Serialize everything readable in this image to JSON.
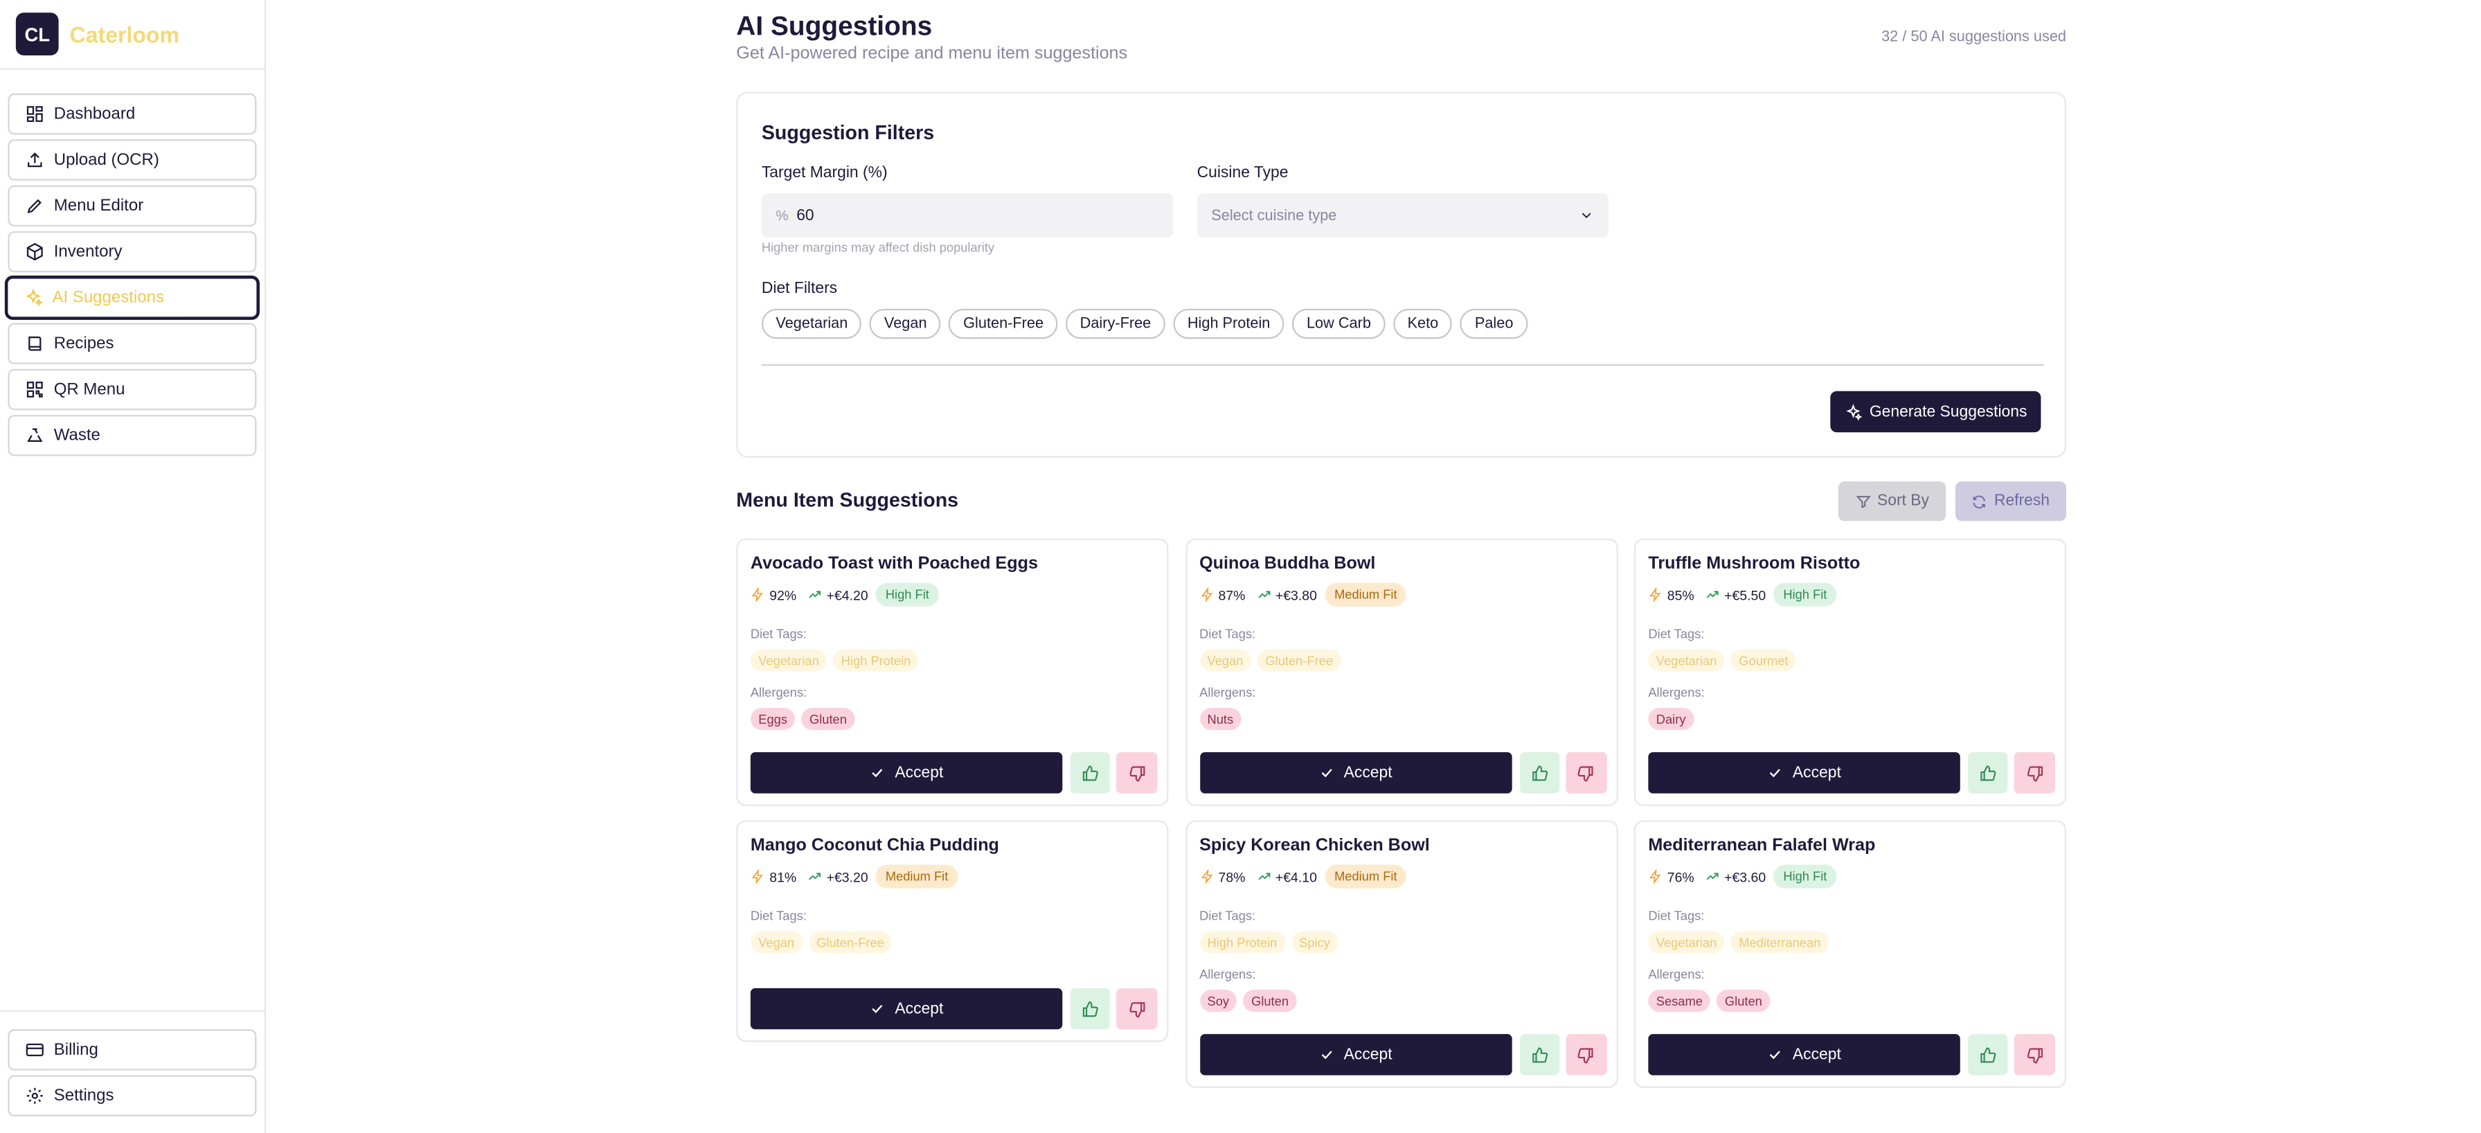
{
  "brand": {
    "logo": "CL",
    "name": "Caterloom"
  },
  "sidebar": {
    "items": [
      {
        "label": "Dashboard",
        "icon": "grid-icon"
      },
      {
        "label": "Upload (OCR)",
        "icon": "upload-icon"
      },
      {
        "label": "Menu Editor",
        "icon": "pencil-icon"
      },
      {
        "label": "Inventory",
        "icon": "package-icon"
      },
      {
        "label": "AI Suggestions",
        "icon": "sparkles-icon",
        "active": true
      },
      {
        "label": "Recipes",
        "icon": "book-icon"
      },
      {
        "label": "QR Menu",
        "icon": "qr-icon"
      },
      {
        "label": "Waste",
        "icon": "recycle-icon"
      }
    ],
    "bottom": [
      {
        "label": "Billing",
        "icon": "credit-card-icon"
      },
      {
        "label": "Settings",
        "icon": "gear-icon"
      }
    ]
  },
  "header": {
    "title": "AI Suggestions",
    "subtitle": "Get AI-powered recipe and menu item suggestions",
    "usage": "32 / 50 AI suggestions used"
  },
  "filters": {
    "title": "Suggestion Filters",
    "margin_label": "Target Margin (%)",
    "margin_prefix": "%",
    "margin_value": "60",
    "margin_hint": "Higher margins may affect dish popularity",
    "cuisine_label": "Cuisine Type",
    "cuisine_placeholder": "Select cuisine type",
    "diet_label": "Diet Filters",
    "diet_options": [
      "Vegetarian",
      "Vegan",
      "Gluten-Free",
      "Dairy-Free",
      "High Protein",
      "Low Carb",
      "Keto",
      "Paleo"
    ],
    "generate_label": "Generate Suggestions"
  },
  "suggestions": {
    "title": "Menu Item Suggestions",
    "sort_label": "Sort By",
    "refresh_label": "Refresh",
    "diet_tags_label": "Diet Tags:",
    "allergens_label": "Allergens:",
    "accept_label": "Accept",
    "items": [
      {
        "name": "Avocado Toast with Poached Eggs",
        "score": "92%",
        "profit": "+€4.20",
        "fit": "High Fit",
        "fit_level": "high",
        "diet_tags": [
          "Vegetarian",
          "High Protein"
        ],
        "allergens": [
          "Eggs",
          "Gluten"
        ]
      },
      {
        "name": "Quinoa Buddha Bowl",
        "score": "87%",
        "profit": "+€3.80",
        "fit": "Medium Fit",
        "fit_level": "medium",
        "diet_tags": [
          "Vegan",
          "Gluten-Free"
        ],
        "allergens": [
          "Nuts"
        ]
      },
      {
        "name": "Truffle Mushroom Risotto",
        "score": "85%",
        "profit": "+€5.50",
        "fit": "High Fit",
        "fit_level": "high",
        "diet_tags": [
          "Vegetarian",
          "Gourmet"
        ],
        "allergens": [
          "Dairy"
        ]
      },
      {
        "name": "Mango Coconut Chia Pudding",
        "score": "81%",
        "profit": "+€3.20",
        "fit": "Medium Fit",
        "fit_level": "medium",
        "diet_tags": [
          "Vegan",
          "Gluten-Free"
        ],
        "allergens": []
      },
      {
        "name": "Spicy Korean Chicken Bowl",
        "score": "78%",
        "profit": "+€4.10",
        "fit": "Medium Fit",
        "fit_level": "medium",
        "diet_tags": [
          "High Protein",
          "Spicy"
        ],
        "allergens": [
          "Soy",
          "Gluten"
        ]
      },
      {
        "name": "Mediterranean Falafel Wrap",
        "score": "76%",
        "profit": "+€3.60",
        "fit": "High Fit",
        "fit_level": "high",
        "diet_tags": [
          "Vegetarian",
          "Mediterranean"
        ],
        "allergens": [
          "Sesame",
          "Gluten"
        ]
      }
    ]
  },
  "colors": {
    "primary": "#1f1a3a",
    "accent": "#f2c94c",
    "high_fit_bg": "#dcf3e4",
    "medium_fit_bg": "#fde9cc",
    "allergen_bg": "#fbd3de"
  }
}
